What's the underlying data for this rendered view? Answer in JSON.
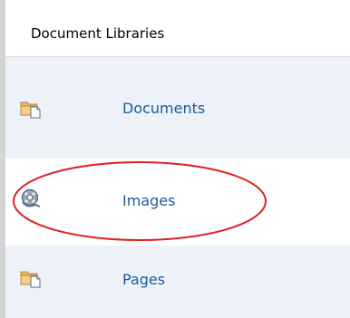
{
  "section": {
    "title": "Document Libraries"
  },
  "libraries": [
    {
      "label": "Documents",
      "icon": "folder-document-icon"
    },
    {
      "label": "Images",
      "icon": "image-library-icon"
    },
    {
      "label": "Pages",
      "icon": "folder-document-icon"
    }
  ],
  "colors": {
    "link": "#1a5aa0",
    "row_shade": "#edf2f8",
    "annotation": "#e02020"
  }
}
